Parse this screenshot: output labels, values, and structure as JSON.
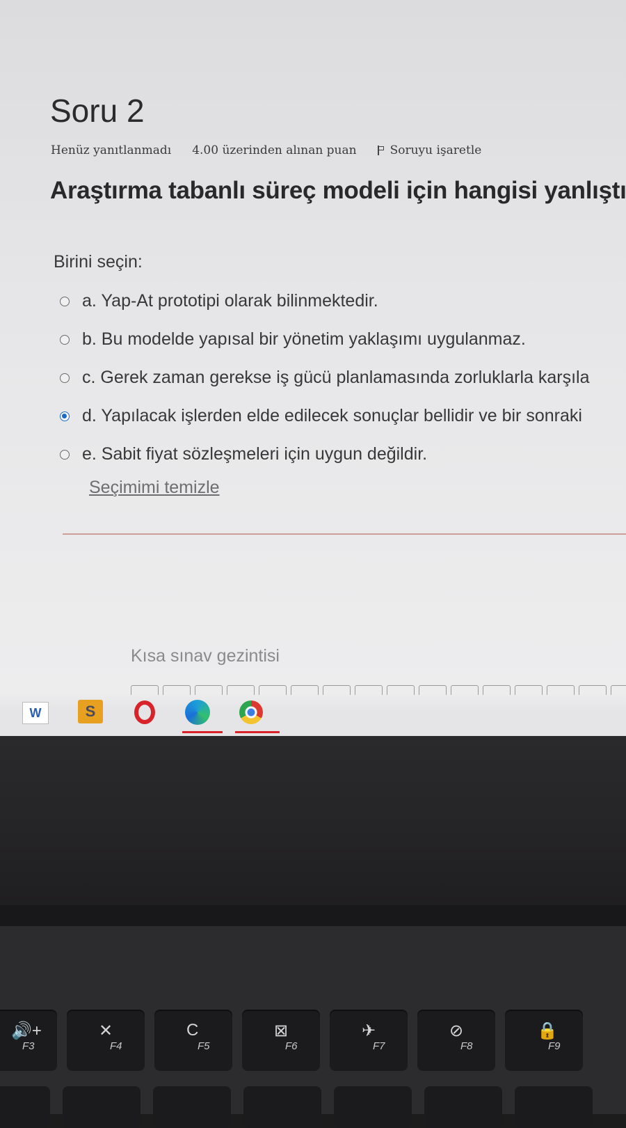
{
  "question": {
    "title": "Soru 2",
    "status": "Henüz yanıtlanmadı",
    "points": "4.00 üzerinden alınan puan",
    "flag_label": "Soruyu işaretle",
    "text": "Araştırma tabanlı süreç modeli için hangisi yanlıştır"
  },
  "answer": {
    "prompt": "Birini seçin:",
    "selected": "d",
    "options": [
      {
        "id": "a",
        "label": "a. Yap-At prototipi olarak bilinmektedir."
      },
      {
        "id": "b",
        "label": "b. Bu modelde yapısal bir yönetim yaklaşımı uygulanmaz."
      },
      {
        "id": "c",
        "label": "c. Gerek zaman gerekse iş gücü planlamasında zorluklarla karşıla"
      },
      {
        "id": "d",
        "label": "d. Yapılacak işlerden elde edilecek sonuçlar bellidir ve bir sonraki"
      },
      {
        "id": "e",
        "label": "e. Sabit fiyat sözleşmeleri için uygun değildir."
      }
    ],
    "clear_label": "Seçimimi temizle"
  },
  "quiz_nav": {
    "title": "Kısa sınav gezintisi",
    "question_count": 16
  },
  "taskbar": {
    "apps": [
      {
        "name": "word-icon",
        "label": "W"
      },
      {
        "name": "sublime-icon",
        "label": "S"
      },
      {
        "name": "opera-icon",
        "label": ""
      },
      {
        "name": "edge-icon",
        "label": ""
      },
      {
        "name": "chrome-icon",
        "label": ""
      }
    ]
  },
  "keyboard": {
    "fn_keys": [
      {
        "fn": "F3",
        "glyph": "🔊+",
        "icon": "volume-up-icon"
      },
      {
        "fn": "F4",
        "glyph": "✕",
        "icon": "mic-mute-icon"
      },
      {
        "fn": "F5",
        "glyph": "C",
        "icon": "refresh-icon"
      },
      {
        "fn": "F6",
        "glyph": "⊠",
        "icon": "touchpad-off-icon"
      },
      {
        "fn": "F7",
        "glyph": "✈",
        "icon": "airplane-mode-icon"
      },
      {
        "fn": "F8",
        "glyph": "⊘",
        "icon": "camera-off-icon"
      },
      {
        "fn": "F9",
        "glyph": "🔒",
        "icon": "lock-icon"
      }
    ]
  },
  "colors": {
    "radio_selected": "#1b6ac9",
    "divider": "#c89088",
    "opera_red": "#d8232a"
  }
}
